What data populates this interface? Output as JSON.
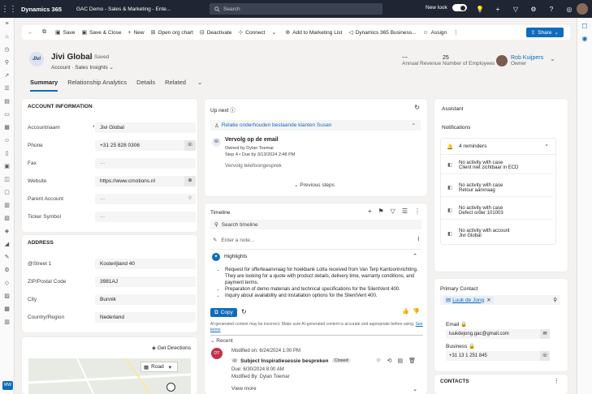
{
  "topbar": {
    "app_name": "Dynamics 365",
    "breadcrumb": "GAC Demo - Sales & Marketing - Ente...",
    "search_placeholder": "Search",
    "new_look_label": "New look"
  },
  "commands": {
    "save": "Save",
    "save_close": "Save & Close",
    "new": "New",
    "org_chart": "Open org chart",
    "deactivate": "Deactivate",
    "connect": "Connect",
    "add_marketing": "Add to Marketing List",
    "business_card": "Dynamics 365 Business...",
    "assign": "Assign",
    "share": "Share"
  },
  "header": {
    "logo_text": "Jivi",
    "account_name": "Jivi Global",
    "saved_status": "- Saved",
    "entity": "Account",
    "form": "Sales Insights",
    "annual_revenue_value": "---",
    "annual_revenue_label": "Annual Revenue",
    "employees_value": "25",
    "employees_label": "Number of Employees",
    "owner_name": "Rob Kuijpers",
    "owner_label": "Owner"
  },
  "tabs": [
    "Summary",
    "Relationship Analytics",
    "Details",
    "Related"
  ],
  "account_info": {
    "title": "ACCOUNT INFORMATION",
    "fields": [
      {
        "label": "Accountnaam",
        "value": "Jivi Global"
      },
      {
        "label": "Phone",
        "value": "+31 25 828 0306"
      },
      {
        "label": "Fax",
        "value": "---"
      },
      {
        "label": "Website",
        "value": "https://www.cmotions.nl"
      },
      {
        "label": "Parent Account",
        "value": "---"
      },
      {
        "label": "Ticker Symbol",
        "value": "---"
      }
    ]
  },
  "address": {
    "title": "ADDRESS",
    "fields": [
      {
        "label": "@Street 1",
        "value": "Kosterijland 40"
      },
      {
        "label": "ZIP/Postal Code",
        "value": "3981AJ"
      },
      {
        "label": "City",
        "value": "Bunnik"
      },
      {
        "label": "Country/Region",
        "value": "Nederland"
      }
    ]
  },
  "map": {
    "directions": "Get Directions",
    "road": "Road"
  },
  "upnext": {
    "title": "Up next",
    "sequence": "Relatie onderhouden bestaande klanten Susan",
    "step_title": "Vervolg op de email",
    "owned_by": "Owned by Dylan Toemar",
    "step_info": "Step 4 • Due by 3/13/2024 2:48 PM",
    "next_step": "Vervolg telefoongesprek",
    "previous": "Previous steps"
  },
  "timeline": {
    "title": "Timeline",
    "search_placeholder": "Search timeline",
    "note_placeholder": "Enter a note...",
    "highlights_title": "Highlights",
    "highlights": [
      "Request for offerteaanvraag for hoekbank Lotta received from Van Terp Kantoorinrichting. They are looking for a quote with product details, delivery time, warranty conditions, and payment terms.",
      "Preparation of demo materials and technical specifications for the SilentVent 400.",
      "Inquiry about availability and installation options for the SilentVent 400."
    ],
    "copy": "Copy",
    "disclaimer": "AI-generated content may be incorrect. Make sure AI-generated content is accurate and appropriate before using.",
    "see_terms": "See terms",
    "recent": "Recent",
    "item_modified": "Modified on: 6/24/2024 1:00 PM",
    "item_subject": "Subject Inspiratiesessie bespreken",
    "item_status": "Closed",
    "item_due": "Due: 6/30/2024 8:00 AM",
    "item_by": "Modified By: Dylan Toemar",
    "view_more": "View more",
    "avatar_initials": "DT"
  },
  "assistant": {
    "title": "Assistant",
    "notifications": "Notifications",
    "reminders_count": "4 reminders",
    "reminders": [
      {
        "line1": "No activity with case",
        "line2": "Client niet zichtbaar in ECD"
      },
      {
        "line1": "No activity with case",
        "line2": "Retour aanvraag"
      },
      {
        "line1": "No activity with case",
        "line2": "Defect order 101003"
      },
      {
        "line1": "No activity with account",
        "line2": "Jivi Global"
      }
    ]
  },
  "primary_contact": {
    "title": "Primary Contact",
    "name": "Luuk de Jong",
    "email_label": "Email",
    "email": "luukdejong.gac@gmail.com",
    "business_label": "Business",
    "business": "+31 13 1 251 845"
  },
  "contacts": {
    "title": "CONTACTS"
  }
}
